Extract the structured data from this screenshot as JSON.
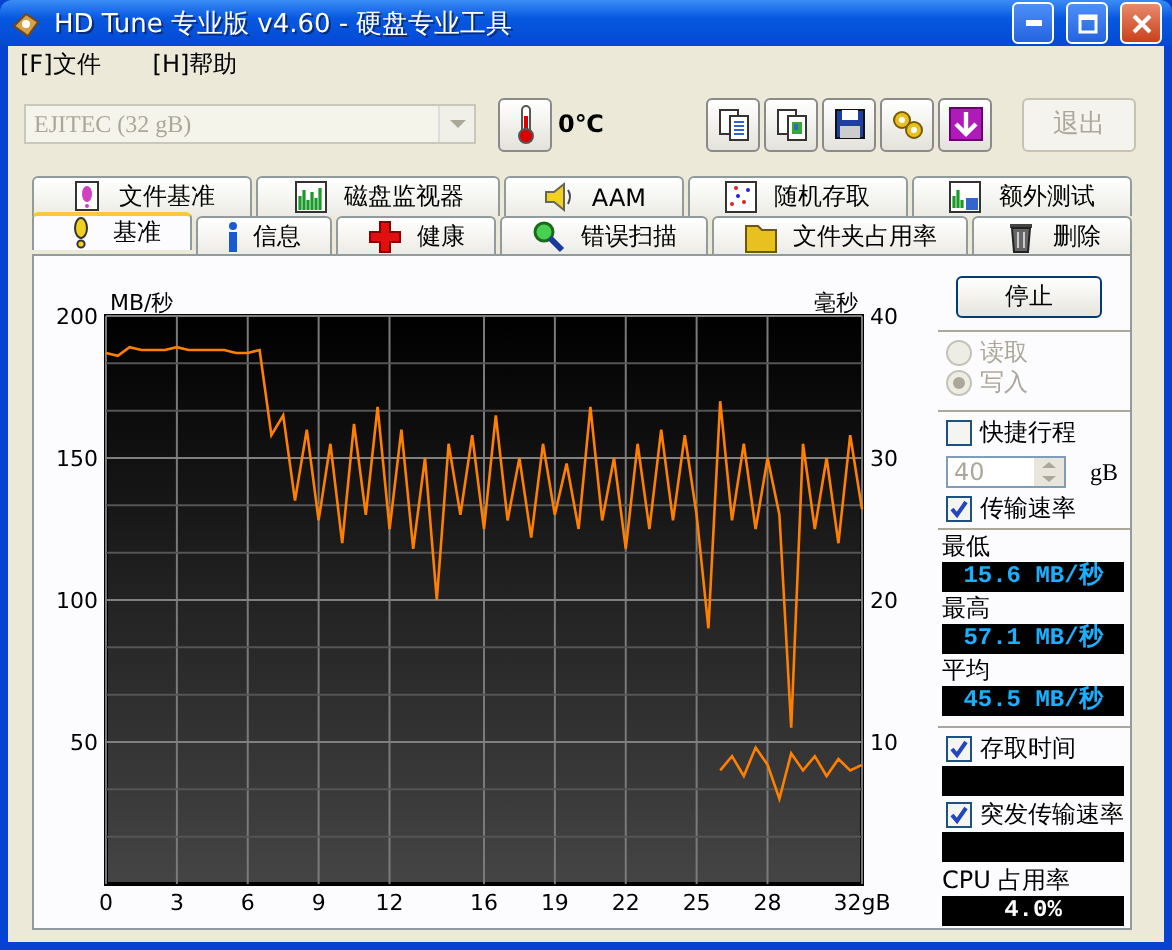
{
  "window": {
    "title": "HD Tune 专业版 v4.60 - 硬盘专业工具"
  },
  "menu": [
    "[F]文件",
    "[H]帮助"
  ],
  "toolbar": {
    "drive": {
      "value": "EJITEC (32 gB)",
      "disabled": true
    },
    "temperature": "0℃",
    "exit_button": {
      "label": "退出",
      "disabled": true
    }
  },
  "tab_rows": [
    {
      "tabs": [
        {
          "label": "文件基准",
          "selected": false
        },
        {
          "label": "磁盘监视器",
          "selected": false
        },
        {
          "label": "AAM",
          "selected": false
        },
        {
          "label": "随机存取",
          "selected": false
        },
        {
          "label": "额外测试",
          "selected": false
        }
      ]
    },
    {
      "tabs": [
        {
          "label": "基准",
          "selected": true
        },
        {
          "label": "信息",
          "selected": false
        },
        {
          "label": "健康",
          "selected": false
        },
        {
          "label": "错误扫描",
          "selected": false
        },
        {
          "label": "文件夹占用率",
          "selected": false
        },
        {
          "label": "删除",
          "selected": false
        }
      ]
    }
  ],
  "benchmark": {
    "chart_data": {
      "type": "line",
      "ylabel": "MB/秒",
      "xlim": [
        0,
        32
      ],
      "ylim": [
        0,
        200
      ],
      "yticks": [
        50,
        100,
        150,
        200
      ],
      "xticks": [
        0,
        3,
        6,
        9,
        12,
        16,
        19,
        22,
        25,
        28,
        {
          "value": 32,
          "label": "32gB"
        }
      ],
      "grid": true,
      "x": [
        0,
        0.5,
        1,
        1.5,
        2,
        2.5,
        3,
        3.5,
        4,
        4.5,
        5,
        5.5,
        6,
        6.5,
        7,
        7.5,
        8,
        8.5,
        9,
        9.5,
        10,
        10.5,
        11,
        11.5,
        12,
        12.5,
        13,
        13.5,
        14,
        14.5,
        15,
        15.5,
        16,
        16.5,
        17,
        17.5,
        18,
        18.5,
        19,
        19.5,
        20,
        20.5,
        21,
        21.5,
        22,
        22.5,
        23,
        23.5,
        24,
        24.5,
        25,
        25.5,
        26,
        26.5,
        27,
        27.5,
        28,
        28.5,
        29,
        29.5,
        30,
        30.5,
        31,
        31.5,
        32
      ],
      "series": [
        {
          "color": "#ff8000",
          "values": [
            187,
            186,
            189,
            188,
            188,
            188,
            189,
            188,
            188,
            188,
            188,
            187,
            187,
            188,
            158,
            165,
            135,
            160,
            128,
            155,
            120,
            162,
            130,
            168,
            125,
            160,
            118,
            150,
            100,
            155,
            130,
            158,
            125,
            165,
            128,
            150,
            122,
            155,
            130,
            148,
            125,
            168,
            128,
            150,
            118,
            155,
            125,
            160,
            128,
            158,
            130,
            90,
            170,
            128,
            155,
            125,
            150,
            130,
            55,
            155,
            125,
            150,
            120,
            158,
            132
          ]
        },
        {
          "color": "#ff8000",
          "values": [
            null,
            null,
            null,
            null,
            null,
            null,
            null,
            null,
            null,
            null,
            null,
            null,
            null,
            null,
            null,
            null,
            null,
            null,
            null,
            null,
            null,
            null,
            null,
            null,
            null,
            null,
            null,
            null,
            null,
            null,
            null,
            null,
            null,
            null,
            null,
            null,
            null,
            null,
            null,
            null,
            null,
            null,
            null,
            null,
            null,
            null,
            null,
            null,
            null,
            null,
            null,
            null,
            40,
            45,
            38,
            48,
            42,
            30,
            46,
            40,
            45,
            38,
            44,
            40,
            42
          ]
        }
      ]
    },
    "right_axis": {
      "unit": "毫秒",
      "ticks": [
        "40",
        "30",
        "20",
        "10"
      ]
    }
  },
  "side": {
    "stop_button": "停止",
    "mode": [
      {
        "label": "读取",
        "selected": false,
        "disabled": true
      },
      {
        "label": "写入",
        "selected": true,
        "disabled": true
      }
    ],
    "short_stroke": {
      "label": "快捷行程",
      "checked": false
    },
    "stroke_size": {
      "value": "40",
      "unit": "gB",
      "disabled": true
    },
    "transfer_rate": {
      "label": "传输速率",
      "checked": true
    },
    "stats": [
      {
        "label": "最低",
        "value": "15.6 MB/秒"
      },
      {
        "label": "最高",
        "value": "57.1 MB/秒"
      },
      {
        "label": "平均",
        "value": "45.5 MB/秒"
      }
    ],
    "access_time": {
      "label": "存取时间",
      "checked": true
    },
    "burst_rate": {
      "label": "突发传输速率",
      "checked": true
    },
    "cpu": {
      "label": "CPU 占用率",
      "value": "4.0%"
    }
  }
}
